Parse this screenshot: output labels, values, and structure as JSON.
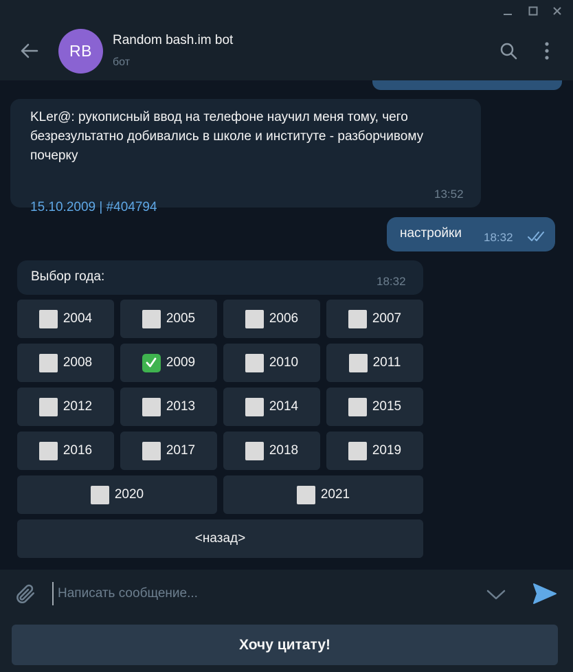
{
  "window": {
    "controls": [
      "minimize-icon",
      "maximize-icon",
      "close-icon"
    ]
  },
  "header": {
    "avatar_initials": "RB",
    "avatar_color": "#8a63d2",
    "name": "Random bash.im bot",
    "status": "бот",
    "icons": [
      "back-arrow-icon",
      "search-icon",
      "more-vertical-icon"
    ]
  },
  "messages": {
    "quote": {
      "text": "KLer@: рукописный ввод на телефоне научил меня тому, чего безрезультатно добивались в школе и институте - разборчивому почерку",
      "link": "15.10.2009 | #404794",
      "time": "13:52"
    },
    "outgoing": {
      "text": "настройки",
      "time": "18:32",
      "status_icon": "double-check-icon"
    },
    "year_picker": {
      "text": "Выбор года:",
      "time": "18:32"
    }
  },
  "keyboard": {
    "rows": [
      [
        {
          "label": "2004",
          "checked": false
        },
        {
          "label": "2005",
          "checked": false
        },
        {
          "label": "2006",
          "checked": false
        },
        {
          "label": "2007",
          "checked": false
        }
      ],
      [
        {
          "label": "2008",
          "checked": false
        },
        {
          "label": "2009",
          "checked": true
        },
        {
          "label": "2010",
          "checked": false
        },
        {
          "label": "2011",
          "checked": false
        }
      ],
      [
        {
          "label": "2012",
          "checked": false
        },
        {
          "label": "2013",
          "checked": false
        },
        {
          "label": "2014",
          "checked": false
        },
        {
          "label": "2015",
          "checked": false
        }
      ],
      [
        {
          "label": "2016",
          "checked": false
        },
        {
          "label": "2017",
          "checked": false
        },
        {
          "label": "2018",
          "checked": false
        },
        {
          "label": "2019",
          "checked": false
        }
      ],
      [
        {
          "label": "2020",
          "checked": false
        },
        {
          "label": "2021",
          "checked": false
        }
      ]
    ],
    "back_label": "<назад>"
  },
  "composer": {
    "placeholder": "Написать сообщение...",
    "value": ""
  },
  "reply_keyboard": {
    "button_label": "Хочу цитату!"
  },
  "colors": {
    "background": "#0e1621",
    "panel": "#17212b",
    "incoming_bubble": "#182533",
    "outgoing_bubble": "#2b5278",
    "link": "#5fa8e6",
    "accent": "#5fa8e6",
    "checked": "#3fb34f"
  }
}
